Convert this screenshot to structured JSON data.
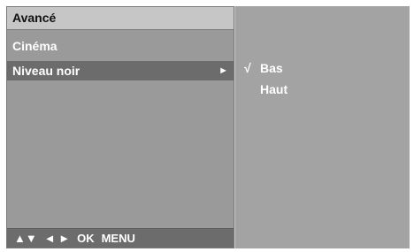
{
  "menu": {
    "title": "Avancé",
    "items": [
      {
        "label": "Cinéma"
      },
      {
        "label": "Niveau noir",
        "arrow": "►"
      }
    ]
  },
  "submenu": {
    "options": [
      {
        "check": "√",
        "label": "Bas"
      },
      {
        "check": "",
        "label": "Haut"
      }
    ]
  },
  "footer": {
    "nav_updown": "▲▼",
    "nav_leftright": "◄ ►",
    "ok": "OK",
    "menu": "MENU"
  }
}
